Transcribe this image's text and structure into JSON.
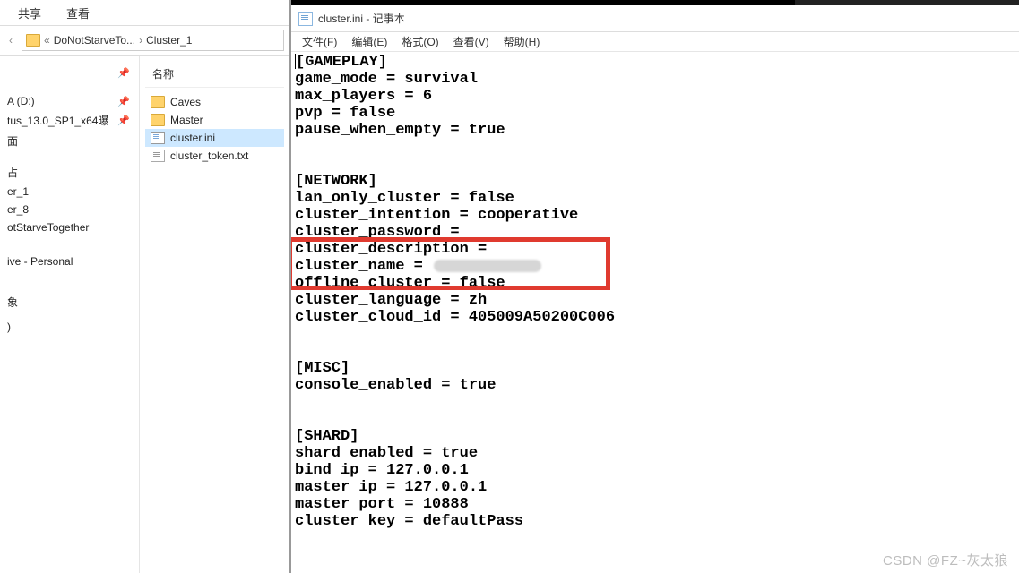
{
  "explorer": {
    "tabs": {
      "share": "共享",
      "view": "查看"
    },
    "breadcrumb": {
      "seg1": "DoNotStarveTo...",
      "seg2": "Cluster_1"
    },
    "nav": [
      "",
      "A (D:)",
      "tus_13.0_SP1_x64曝",
      "面",
      "占",
      "er_1",
      "er_8",
      "otStarveTogether",
      "",
      "ive - Personal",
      "",
      "",
      "象",
      "",
      ")"
    ],
    "nav_pins": [
      true,
      true,
      true,
      false,
      false,
      false,
      false,
      false,
      false,
      false,
      false,
      false,
      false,
      false,
      false
    ],
    "nav_spacer_after": [
      0,
      3,
      7,
      9
    ],
    "file_header": "名称",
    "files": [
      {
        "name": "Caves",
        "type": "folder",
        "selected": false
      },
      {
        "name": "Master",
        "type": "folder",
        "selected": false
      },
      {
        "name": "cluster.ini",
        "type": "ini",
        "selected": true
      },
      {
        "name": "cluster_token.txt",
        "type": "txt",
        "selected": false
      }
    ]
  },
  "notepad": {
    "title": "cluster.ini - 记事本",
    "menu": {
      "file": "文件(F)",
      "edit": "编辑(E)",
      "format": "格式(O)",
      "view": "查看(V)",
      "help": "帮助(H)"
    },
    "content_prefix_caret": "",
    "lines": [
      "[GAMEPLAY]",
      "game_mode = survival",
      "max_players = 6",
      "pvp = false",
      "pause_when_empty = true",
      "",
      "",
      "[NETWORK]",
      "lan_only_cluster = false",
      "cluster_intention = cooperative",
      "cluster_password =",
      "cluster_description =",
      "cluster_name = ",
      "offline_cluster = false",
      "cluster_language = zh",
      "cluster_cloud_id = 405009A50200C006",
      "",
      "",
      "[MISC]",
      "console_enabled = true",
      "",
      "",
      "[SHARD]",
      "shard_enabled = true",
      "bind_ip = 127.0.0.1",
      "master_ip = 127.0.0.1",
      "master_port = 10888",
      "cluster_key = defaultPass"
    ],
    "blur_line_index": 12,
    "red_highlight_start": 11,
    "red_highlight_end": 13
  },
  "watermark": "CSDN @FZ~灰太狼"
}
